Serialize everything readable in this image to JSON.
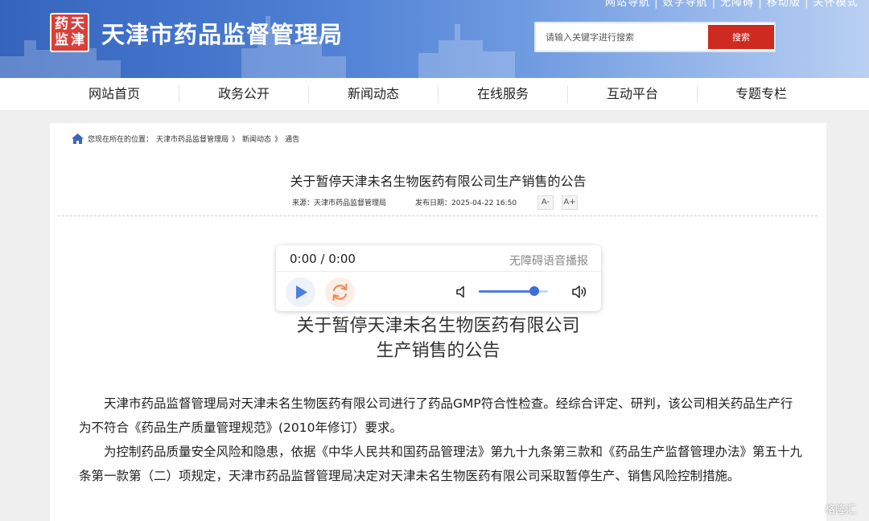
{
  "header": {
    "top_links": "网站导航 | 数字导航 | 无障碍 | 移动版 | 关怀模式",
    "logo_text": "天津药监",
    "logo_chars": [
      "天",
      "津",
      "药",
      "监"
    ],
    "site_title": "天津市药品监督管理局",
    "search": {
      "placeholder": "请输入关键字进行搜索",
      "value": "",
      "button_label": "搜索"
    }
  },
  "nav": {
    "items": [
      {
        "label": "网站首页"
      },
      {
        "label": "政务公开"
      },
      {
        "label": "新闻动态"
      },
      {
        "label": "在线服务"
      },
      {
        "label": "互动平台"
      },
      {
        "label": "专题专栏"
      }
    ]
  },
  "breadcrumb": {
    "icon": "home-icon",
    "prefix": "您现在所在的位置：",
    "items": [
      "天津市药品监督管理局",
      "新闻动态",
      "通告"
    ],
    "separator": "》"
  },
  "article": {
    "title": "关于暂停天津未名生物医药有限公司生产销售的公告",
    "source": "来源：天津市药品监督管理局",
    "date": "发布日期：2025-04-22 16:50",
    "font_decrease": "A-",
    "font_increase": "A+",
    "heading_lines": [
      "关于暂停天津未名生物医药有限公司",
      "生产销售的公告"
    ],
    "paragraphs": [
      "天津市药品监督管理局对天津未名生物医药有限公司进行了药品GMP符合性检查。经综合评定、研判，该公司相关药品生产行为不符合《药品生产质量管理规范》(2010年修订）要求。",
      "为控制药品质量安全风险和隐患，依据《中华人民共和国药品管理法》第九十九条第三款和《药品生产监督管理办法》第五十九条第一款第（二）项规定，天津市药品监督管理局决定对天津未名生物医药有限公司采取暂停生产、销售风险控制措施。"
    ]
  },
  "player": {
    "time": "0:00 / 0:00",
    "accessibility_label": "无障碍语音播报",
    "volume": 0.8,
    "colors": {
      "accent": "#4e7de0",
      "reload": "#ef8a55"
    }
  },
  "watermark": {
    "text": "格隆汇",
    "icon": "gelonghui-logo-icon"
  },
  "colors": {
    "header_blue": "#3564bd",
    "search_red": "#cf2a20",
    "logo_red": "#d8403a"
  }
}
